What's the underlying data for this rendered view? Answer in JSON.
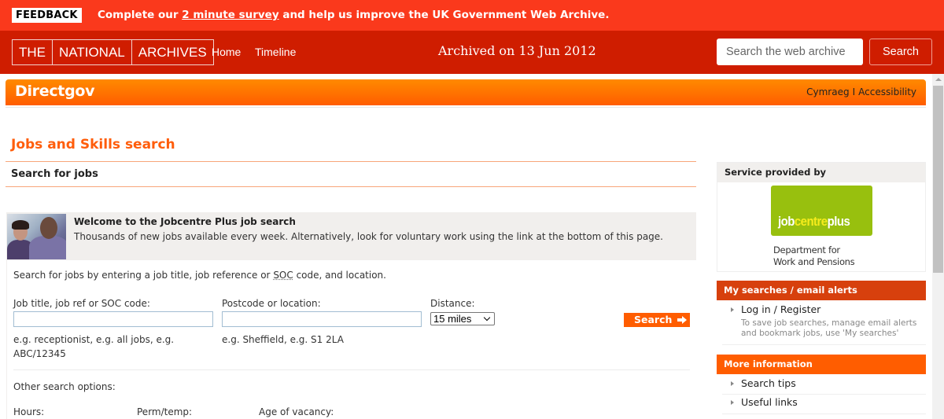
{
  "feedback": {
    "badge": "FEEDBACK",
    "text_before": "Complete our ",
    "link": "2 minute survey",
    "text_after": " and help us improve the UK Government Web Archive."
  },
  "archive_bar": {
    "logo": [
      "THE",
      "NATIONAL",
      "ARCHIVES"
    ],
    "nav": [
      "Home",
      "Timeline"
    ],
    "archived_label": "Archived on 13 Jun 2012",
    "search_placeholder": "Search the web archive",
    "search_button": "Search"
  },
  "directgov": {
    "logo": "Directgov",
    "links": [
      "Cymraeg",
      "Accessibility"
    ],
    "link_separator": "I"
  },
  "main": {
    "page_title": "Jobs and Skills search",
    "section_title": "Search for jobs",
    "welcome": {
      "title": "Welcome to the Jobcentre Plus job search",
      "text": "Thousands of new jobs available every week. Alternatively, look for voluntary work using the link at the bottom of this page."
    },
    "intro": {
      "before": "Search for jobs by entering a job title, job reference or ",
      "abbr": "SOC",
      "after": " code, and location."
    },
    "form": {
      "job_label": "Job title, job ref or SOC code:",
      "job_value": "",
      "job_hint_line1": "e.g. receptionist, e.g. all jobs, e.g.",
      "job_hint_line2": "ABC/12345",
      "location_label": "Postcode or location:",
      "location_value": "",
      "location_hint": "e.g. Sheffield, e.g. S1 2LA",
      "distance_label": "Distance:",
      "distance_selected": "15 miles",
      "search_button": "Search"
    },
    "other_options": {
      "title": "Other search options:",
      "labels": [
        "Hours:",
        "Perm/temp:",
        "Age of vacancy:"
      ]
    }
  },
  "sidebar": {
    "service": {
      "title": "Service provided by",
      "logo_parts": [
        "job",
        "centre",
        "plus"
      ],
      "dwp_line1": "Department for",
      "dwp_line2": "Work and Pensions"
    },
    "my_searches": {
      "title": "My searches / email alerts",
      "link": "Log in / Register",
      "sub_line1": "To save job searches, manage email alerts",
      "sub_line2": "and bookmark jobs, use 'My searches'",
      "color": "#d7400d"
    },
    "more_info": {
      "title": "More information",
      "links": [
        "Search tips",
        "Useful links"
      ],
      "color": "#ff5d00"
    }
  },
  "colors": {
    "feedback_bg": "#fa391c",
    "archive_bar_bg": "#cf1d00",
    "brand_orange": "#ff5d00",
    "title_orange": "#ff5d0b"
  }
}
